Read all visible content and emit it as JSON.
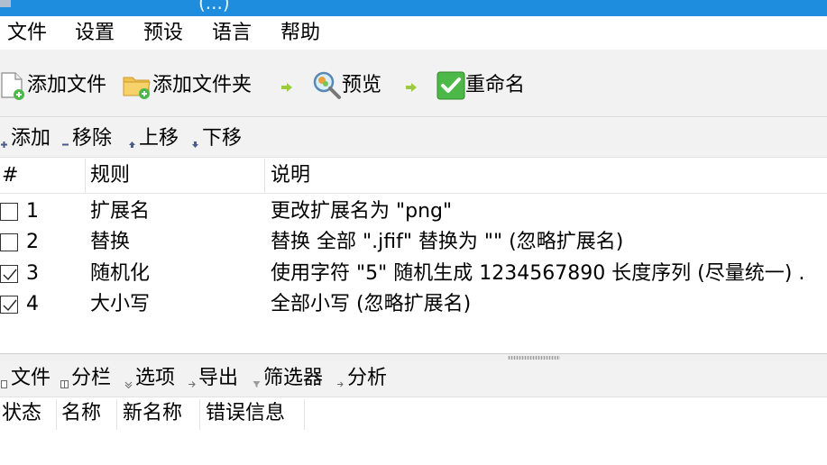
{
  "window": {
    "title": "(...)"
  },
  "menubar": {
    "items": [
      "文件",
      "设置",
      "预设",
      "语言",
      "帮助"
    ]
  },
  "toolbar": {
    "add_files": "添加文件",
    "add_folder": "添加文件夹",
    "preview": "预览",
    "rename": "重命名"
  },
  "rules_toolbar": {
    "add": "添加",
    "remove": "移除",
    "move_up": "上移",
    "move_down": "下移"
  },
  "rules_table": {
    "columns": [
      "#",
      "规则",
      "说明"
    ],
    "rows": [
      {
        "checked": false,
        "index": "1",
        "rule": "扩展名",
        "description": "更改扩展名为 \"png\""
      },
      {
        "checked": false,
        "index": "2",
        "rule": "替换",
        "description": "替换 全部 \".jfif\" 替换为 \"\" (忽略扩展名)"
      },
      {
        "checked": true,
        "index": "3",
        "rule": "随机化",
        "description": "使用字符 \"5\" 随机生成 1234567890 长度序列 (尽量统一) ."
      },
      {
        "checked": true,
        "index": "4",
        "rule": "大小写",
        "description": "全部小写 (忽略扩展名)"
      }
    ]
  },
  "files_toolbar": {
    "files": "文件",
    "columns": "分栏",
    "options": "选项",
    "export": "导出",
    "filter": "筛选器",
    "analyze": "分析"
  },
  "files_table": {
    "columns": [
      "状态",
      "名称",
      "新名称",
      "错误信息"
    ]
  },
  "colors": {
    "titlebar": "#1e8ddd",
    "toolbar_bg": "#f2f2f2",
    "arrow_green": "#9ccc3b",
    "rename_green": "#4cb848"
  },
  "icons": {
    "add_files": "file-plus-icon",
    "add_folder": "folder-plus-icon",
    "preview": "magnifier-icon",
    "rename": "green-check-icon"
  }
}
